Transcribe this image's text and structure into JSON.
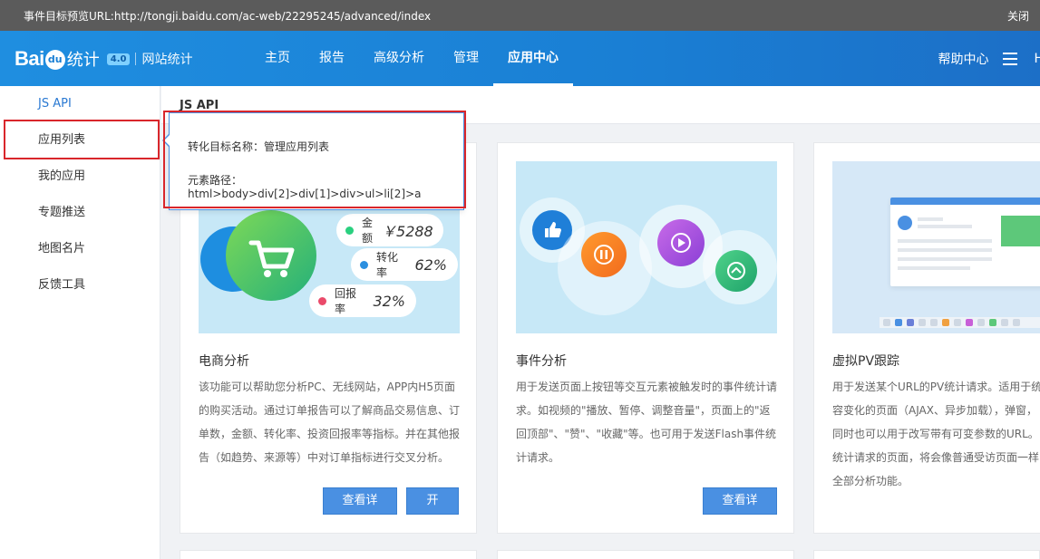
{
  "preview_bar": {
    "url_text": "事件目标预览URL:http://tongji.baidu.com/ac-web/22295245/advanced/index",
    "close_label": "关闭"
  },
  "header": {
    "logo_bai": "Bai",
    "logo_du": "du",
    "logo_tongji": "统计",
    "logo_version": "4.0",
    "logo_site": "网站统计",
    "nav": [
      {
        "label": "主页"
      },
      {
        "label": "报告"
      },
      {
        "label": "高级分析"
      },
      {
        "label": "管理"
      },
      {
        "label": "应用中心",
        "active": true
      }
    ],
    "help_label": "帮助中心",
    "trunc_label": "H"
  },
  "sidebar": {
    "items": [
      {
        "label": "JS API",
        "active": true
      },
      {
        "label": "应用列表"
      },
      {
        "label": "我的应用"
      },
      {
        "label": "专题推送"
      },
      {
        "label": "地图名片"
      },
      {
        "label": "反馈工具"
      }
    ]
  },
  "main": {
    "section_title": "JS API",
    "cards": [
      {
        "title": "电商分析",
        "desc": "该功能可以帮助您分析PC、无线网站，APP内H5页面的购买活动。通过订单报告可以了解商品交易信息、订单数，金额、转化率、投资回报率等指标。并在其他报告（如趋势、来源等）中对订单指标进行交叉分析。",
        "buttons": [
          "查看详情",
          "开通"
        ],
        "metrics": [
          {
            "label": "金额",
            "value": "￥5288",
            "color": "#2ad07f"
          },
          {
            "label": "转化率",
            "value": "62%",
            "color": "#2b8fe0"
          },
          {
            "label": "回报率",
            "value": "32%",
            "color": "#ea4a6a"
          }
        ]
      },
      {
        "title": "事件分析",
        "desc": "用于发送页面上按钮等交互元素被触发时的事件统计请求。如视频的\"播放、暂停、调整音量\"，页面上的\"返回顶部\"、\"赞\"、\"收藏\"等。也可用于发送Flash事件统计请求。",
        "buttons": [
          "查看详情"
        ]
      },
      {
        "title": "虚拟PV跟踪",
        "desc_lines": [
          "用于发送某个URL的PV统计请求。适用于统",
          "容变化的页面（AJAX、异步加载），弹窗，",
          "同时也可以用于改写带有可变参数的URL。",
          "统计请求的页面，将会像普通受访页面一样",
          "全部分析功能。"
        ],
        "buttons": []
      }
    ]
  },
  "tooltip": {
    "name_line": "转化目标名称：管理应用列表",
    "path_line": "元素路径：html>body>div[2]>div[1]>div>ul>li[2]>a"
  },
  "colors": {
    "accent": "#2a79d2",
    "highlight": "#d9262b",
    "button": "#4a90e2"
  }
}
